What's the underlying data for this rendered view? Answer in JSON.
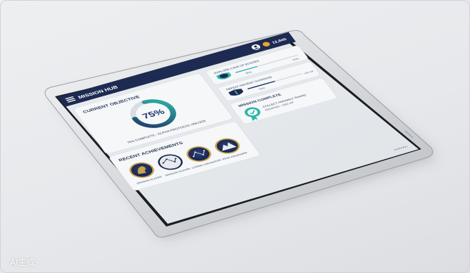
{
  "header": {
    "title": "MISSION HUB",
    "menu_icon": "hamburger-menu-icon",
    "profile_icon": "user-avatar-icon",
    "coin_icon": "coin-icon",
    "balance": "12,845"
  },
  "objective": {
    "heading": "CURRENT OBJECTIVE",
    "progress": 75,
    "progress_label": "75%",
    "caption": "75% COMPLETE - ALPHA PROTOCOL UNLOCK"
  },
  "side_tasks": [
    {
      "icon": "shield-icon",
      "title": "EXPLORE CAVE OF ECHOES",
      "progress": 35,
      "left_label": "35%",
      "right_label": "50%"
    },
    {
      "icon": "sword-shield-icon",
      "title": "DEFEAT ANCIENT GUARDIAN",
      "progress": 50,
      "left_label": "50%",
      "right_label": "+50 XP"
    }
  ],
  "mission_complete": {
    "heading": "MISSION COMPLETE",
    "icon": "verified-badge-icon",
    "line1": "COLLECT ANOMALY SHARD",
    "line2": "REWARD: +500 XP"
  },
  "achievements": {
    "heading": "RECENT ACHIEVEMENTS",
    "items": [
      {
        "label": "DRAGON SLAYER",
        "icon": "dragon-emblem-icon"
      },
      {
        "label": "DRAGON SLAYER",
        "icon": "constellation-emblem-icon"
      },
      {
        "label": "COSMIC NAVIGATOR",
        "icon": "star-map-emblem-icon"
      },
      {
        "label": "PEAK ASCENDER",
        "icon": "mountain-emblem-icon"
      }
    ]
  },
  "watermark": "AI生成",
  "colors": {
    "header_navy": "#1d2a52",
    "panel_bg": "#f2f4f6",
    "accent_teal": "#2fb6a9",
    "progress_navy": "#1f3468",
    "badge_gold": "#c9a44a",
    "text_navy": "#2b3a55"
  }
}
